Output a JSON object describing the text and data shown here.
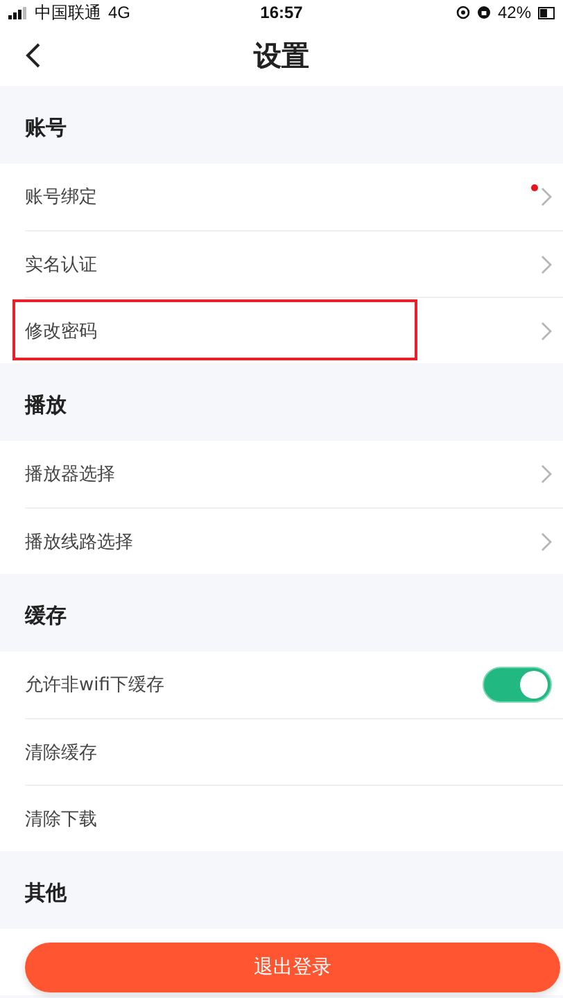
{
  "status_bar": {
    "carrier": "中国联通",
    "network": "4G",
    "time": "16:57",
    "battery": "42%"
  },
  "nav": {
    "title": "设置"
  },
  "sections": [
    {
      "title": "账号",
      "items": [
        {
          "kind": "link",
          "label": "账号绑定",
          "badge": true,
          "highlighted": false
        },
        {
          "kind": "link",
          "label": "实名认证",
          "badge": false,
          "highlighted": false
        },
        {
          "kind": "link",
          "label": "修改密码",
          "badge": false,
          "highlighted": true
        }
      ]
    },
    {
      "title": "播放",
      "items": [
        {
          "kind": "link",
          "label": "播放器选择",
          "badge": false,
          "highlighted": false
        },
        {
          "kind": "link",
          "label": "播放线路选择",
          "badge": false,
          "highlighted": false
        }
      ]
    },
    {
      "title": "缓存",
      "items": [
        {
          "kind": "toggle",
          "label": "允许非wifi下缓存",
          "on": true
        },
        {
          "kind": "plain",
          "label": "清除缓存"
        },
        {
          "kind": "plain",
          "label": "清除下载"
        }
      ]
    },
    {
      "title": "其他",
      "items": [
        {
          "kind": "hidden"
        }
      ]
    }
  ],
  "logout_button": {
    "label": "退出登录"
  }
}
